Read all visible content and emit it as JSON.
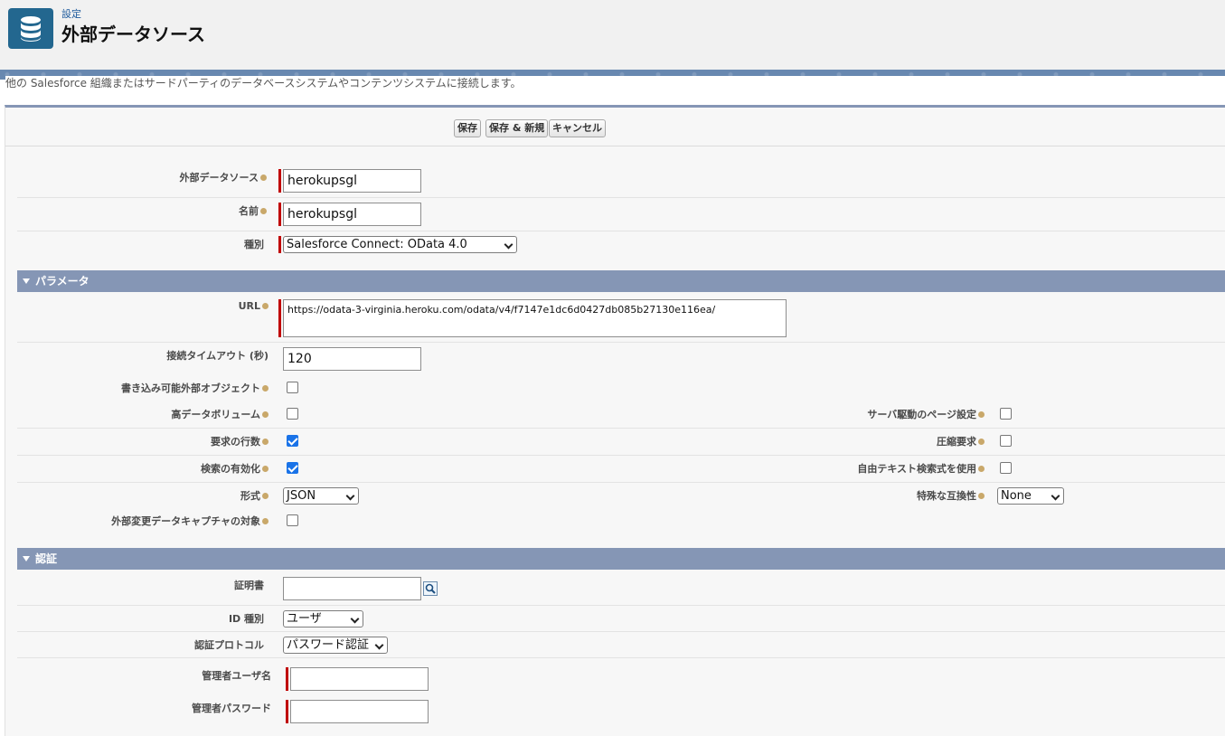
{
  "header": {
    "breadcrumb": "設定",
    "title": "外部データソース",
    "icon": "database-icon"
  },
  "description": "他の Salesforce 組織またはサードパーティのデータベースシステムやコンテンツシステムに接続します。",
  "toolbar": {
    "save": "保存",
    "save_new": "保存 & 新規",
    "cancel": "キャンセル"
  },
  "fields": {
    "external_data_source": {
      "label": "外部データソース",
      "value": "herokupsgl"
    },
    "name": {
      "label": "名前",
      "value": "herokupsgl"
    },
    "type": {
      "label": "種別",
      "value": "Salesforce Connect: OData 4.0"
    }
  },
  "parameters": {
    "section_title": "パラメータ",
    "url": {
      "label": "URL",
      "value": "https://odata-3-virginia.heroku.com/odata/v4/f7147e1dc6d0427db085b27130e116ea/"
    },
    "timeout": {
      "label": "接続タイムアウト (秒)",
      "value": "120"
    },
    "writable": {
      "label": "書き込み可能外部オブジェクト",
      "checked": false
    },
    "high_volume": {
      "label": "高データボリューム",
      "checked": false
    },
    "server_paging": {
      "label": "サーバ駆動のページ設定",
      "checked": false
    },
    "request_row_count": {
      "label": "要求の行数",
      "checked": true
    },
    "compression": {
      "label": "圧縮要求",
      "checked": false
    },
    "search_enabled": {
      "label": "検索の有効化",
      "checked": true
    },
    "free_text_search": {
      "label": "自由テキスト検索式を使用",
      "checked": false
    },
    "format": {
      "label": "形式",
      "value": "JSON"
    },
    "special_compat": {
      "label": "特殊な互換性",
      "value": "None"
    },
    "change_data_capture": {
      "label": "外部変更データキャプチャの対象",
      "checked": false
    }
  },
  "auth": {
    "section_title": "認証",
    "certificate": {
      "label": "証明書",
      "value": ""
    },
    "identity_type": {
      "label": "ID 種別",
      "value": "ユーザ"
    },
    "protocol": {
      "label": "認証プロトコル",
      "value": "パスワード認証"
    },
    "admin_user": {
      "label": "管理者ユーザ名",
      "value": ""
    },
    "admin_password": {
      "label": "管理者パスワード",
      "value": ""
    }
  },
  "colors": {
    "section_bar": "#8596b5",
    "required": "#c00000",
    "checkbox_checked": "#1a73e8",
    "app_icon": "#23678f"
  }
}
